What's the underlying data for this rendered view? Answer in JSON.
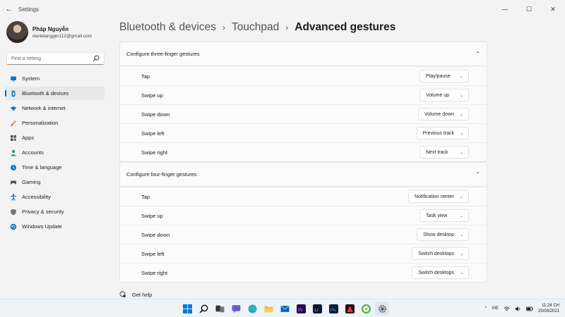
{
  "window": {
    "title": "Settings",
    "back_glyph": "←",
    "controls": {
      "minimize": "—",
      "maximize": "☐",
      "close": "✕"
    }
  },
  "profile": {
    "name": "Pháp Nguyễn",
    "email": "danielangger112@gmail.com"
  },
  "search": {
    "placeholder": "Find a setting"
  },
  "sidebar": {
    "items": [
      {
        "label": "System",
        "icon": "monitor-icon",
        "color": "#0078d4"
      },
      {
        "label": "Bluetooth & devices",
        "icon": "bluetooth-icon",
        "color": "#0078d4",
        "active": true
      },
      {
        "label": "Network & internet",
        "icon": "wifi-icon",
        "color": "#0078d4"
      },
      {
        "label": "Personalization",
        "icon": "brush-icon",
        "color": "#e8a13a"
      },
      {
        "label": "Apps",
        "icon": "apps-icon",
        "color": "#4a5560"
      },
      {
        "label": "Accounts",
        "icon": "person-icon",
        "color": "#21a366"
      },
      {
        "label": "Time & language",
        "icon": "globe-clock-icon",
        "color": "#0078d4"
      },
      {
        "label": "Gaming",
        "icon": "controller-icon",
        "color": "#4a5560"
      },
      {
        "label": "Accessibility",
        "icon": "accessibility-icon",
        "color": "#0a5ea8"
      },
      {
        "label": "Privacy & security",
        "icon": "shield-icon",
        "color": "#6b7580"
      },
      {
        "label": "Windows Update",
        "icon": "update-icon",
        "color": "#0078d4"
      }
    ]
  },
  "breadcrumb": {
    "items": [
      "Bluetooth & devices",
      "Touchpad",
      "Advanced gestures"
    ],
    "separator": "›"
  },
  "three_finger": {
    "title": "Configure three-finger gestures",
    "collapse_glyph": "⌃",
    "rows": [
      {
        "label": "Tap",
        "value": "Play/pause"
      },
      {
        "label": "Swipe up",
        "value": "Volume up"
      },
      {
        "label": "Swipe down",
        "value": "Volume down"
      },
      {
        "label": "Swipe left",
        "value": "Previous track"
      },
      {
        "label": "Swipe right",
        "value": "Next track"
      }
    ]
  },
  "four_finger": {
    "title": "Configure four-finger gestures",
    "collapse_glyph": "⌃",
    "rows": [
      {
        "label": "Tap",
        "value": "Notification center"
      },
      {
        "label": "Swipe up",
        "value": "Task view"
      },
      {
        "label": "Swipe down",
        "value": "Show desktop"
      },
      {
        "label": "Swipe left",
        "value": "Switch desktops"
      },
      {
        "label": "Swipe right",
        "value": "Switch desktops"
      }
    ]
  },
  "dropdown_chevron": "⌄",
  "help": {
    "label": "Get help"
  },
  "taskbar": {
    "apps": [
      "windows-start-icon",
      "search-icon",
      "task-view-icon",
      "chat-icon",
      "edge-icon",
      "file-explorer-icon",
      "mail-icon",
      "premiere-icon",
      "lightroom-icon",
      "photoshop-icon",
      "red-app-icon",
      "green-app-icon",
      "settings-gear-icon"
    ],
    "tray": {
      "chevron": "^",
      "lang": "VIE",
      "time": "11:24 CH",
      "date": "25/08/2021"
    }
  },
  "colors": {
    "accent": "#0067c0"
  }
}
